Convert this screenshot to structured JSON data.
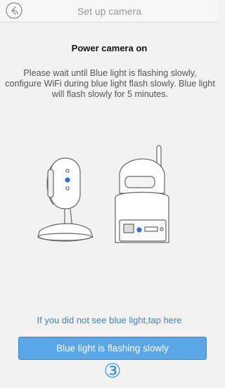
{
  "header": {
    "title": "Set up camera",
    "back_icon": "back-arrow-icon"
  },
  "content": {
    "section_title": "Power camera on",
    "instructions": "Please wait until Blue light is flashing slowly, configure WiFi during blue light flash slowly. Blue light will flash slowly for 5 minutes.",
    "help_link": "If you did not see blue light,tap here",
    "confirm_button": "Blue light is flashing slowly",
    "step_badge": "③"
  },
  "colors": {
    "accent": "#2e8de0",
    "button_fill": "#5aa6e6",
    "link": "#3b88c8",
    "status_light": "#2e6fd8"
  }
}
